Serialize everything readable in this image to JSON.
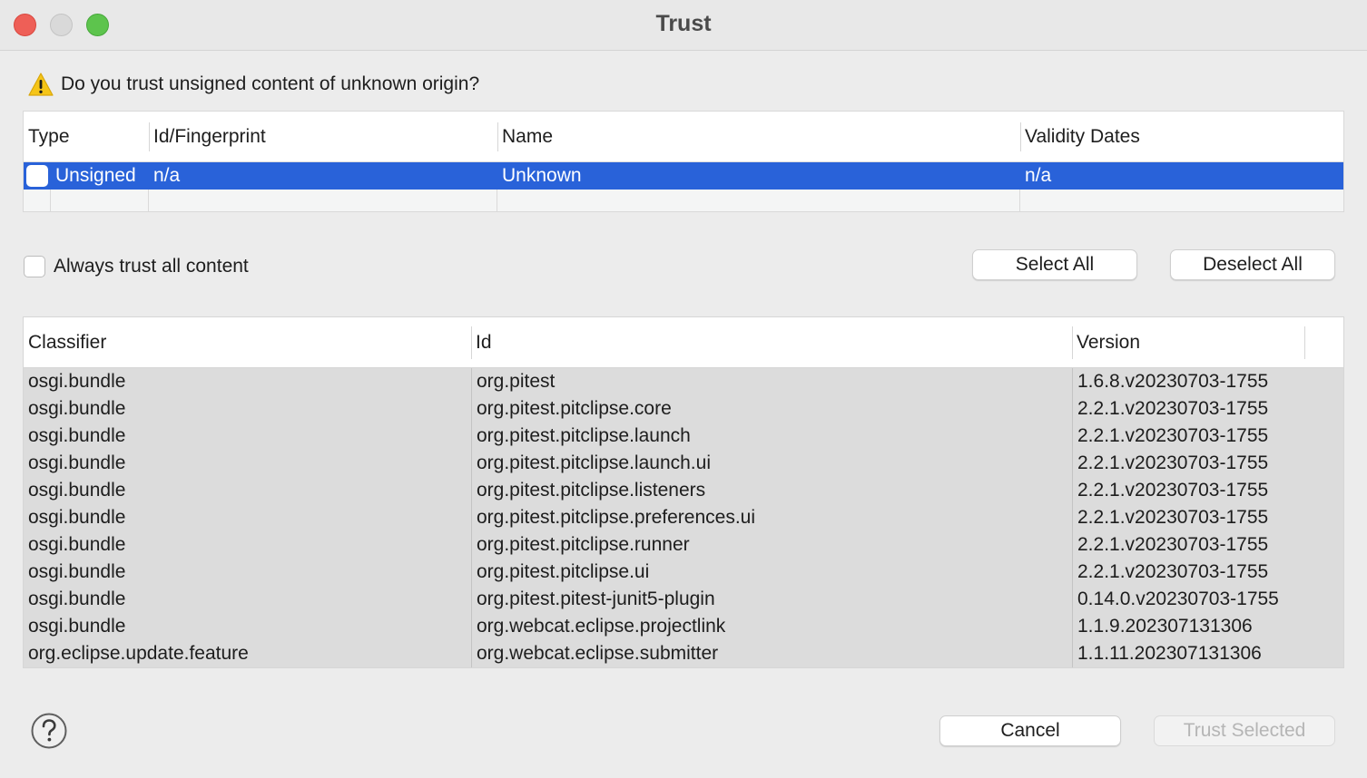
{
  "window": {
    "title": "Trust"
  },
  "prompt": {
    "text": "Do you trust unsigned content of unknown origin?",
    "icon": "warning-icon"
  },
  "certificates": {
    "columns": [
      "Type",
      "Id/Fingerprint",
      "Name",
      "Validity Dates"
    ],
    "rows": [
      {
        "checked": false,
        "type": "Unsigned",
        "id": "n/a",
        "name": "Unknown",
        "validity": "n/a"
      }
    ]
  },
  "always_trust": {
    "label": "Always trust all content",
    "checked": false
  },
  "buttons": {
    "select_all": "Select All",
    "deselect_all": "Deselect All",
    "cancel": "Cancel",
    "trust_selected": "Trust Selected"
  },
  "artifacts": {
    "columns": [
      "Classifier",
      "Id",
      "Version"
    ],
    "rows": [
      {
        "classifier": "osgi.bundle",
        "id": "org.pitest",
        "version": "1.6.8.v20230703-1755"
      },
      {
        "classifier": "osgi.bundle",
        "id": "org.pitest.pitclipse.core",
        "version": "2.2.1.v20230703-1755"
      },
      {
        "classifier": "osgi.bundle",
        "id": "org.pitest.pitclipse.launch",
        "version": "2.2.1.v20230703-1755"
      },
      {
        "classifier": "osgi.bundle",
        "id": "org.pitest.pitclipse.launch.ui",
        "version": "2.2.1.v20230703-1755"
      },
      {
        "classifier": "osgi.bundle",
        "id": "org.pitest.pitclipse.listeners",
        "version": "2.2.1.v20230703-1755"
      },
      {
        "classifier": "osgi.bundle",
        "id": "org.pitest.pitclipse.preferences.ui",
        "version": "2.2.1.v20230703-1755"
      },
      {
        "classifier": "osgi.bundle",
        "id": "org.pitest.pitclipse.runner",
        "version": "2.2.1.v20230703-1755"
      },
      {
        "classifier": "osgi.bundle",
        "id": "org.pitest.pitclipse.ui",
        "version": "2.2.1.v20230703-1755"
      },
      {
        "classifier": "osgi.bundle",
        "id": "org.pitest.pitest-junit5-plugin",
        "version": "0.14.0.v20230703-1755"
      },
      {
        "classifier": "osgi.bundle",
        "id": "org.webcat.eclipse.projectlink",
        "version": "1.1.9.202307131306"
      },
      {
        "classifier": "org.eclipse.update.feature",
        "id": "org.webcat.eclipse.submitter",
        "version": "1.1.11.202307131306"
      }
    ]
  },
  "colors": {
    "selection": "#2962d9",
    "close": "#ee5f57",
    "maximize": "#5dc44d",
    "warning": "#f5c518"
  }
}
